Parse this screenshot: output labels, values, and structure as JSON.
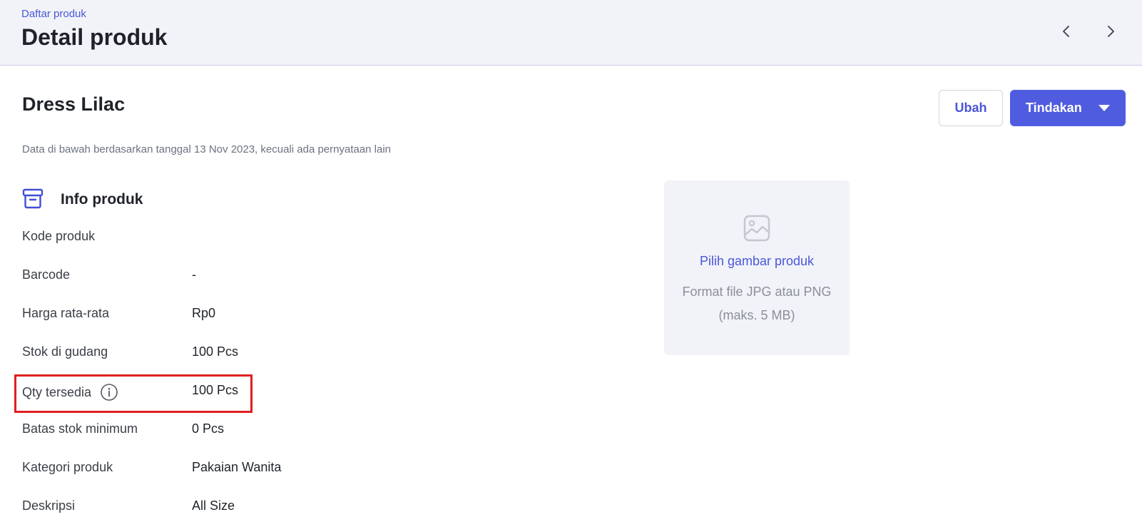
{
  "header": {
    "breadcrumb": "Daftar produk",
    "title": "Detail produk",
    "prev_icon": "chevron-left-icon",
    "next_icon": "chevron-right-icon"
  },
  "product": {
    "name": "Dress Lilac",
    "edit_label": "Ubah",
    "actions_label": "Tindakan",
    "data_note": "Data di bawah berdasarkan tanggal 13 Nov 2023, kecuali ada pernyataan lain"
  },
  "info_section": {
    "icon": "archive-box-icon",
    "title": "Info produk",
    "rows": [
      {
        "label": "Kode produk",
        "value": ""
      },
      {
        "label": "Barcode",
        "value": "-"
      },
      {
        "label": "Harga rata-rata",
        "value": "Rp0"
      },
      {
        "label": "Stok di gudang",
        "value": "100 Pcs"
      },
      {
        "label": "Qty tersedia",
        "value": "100 Pcs",
        "has_info_icon": true
      },
      {
        "label": "Batas stok minimum",
        "value": "0 Pcs"
      },
      {
        "label": "Kategori produk",
        "value": "Pakaian Wanita"
      },
      {
        "label": "Deskripsi",
        "value": "All Size"
      }
    ]
  },
  "image_upload": {
    "icon": "image-placeholder-icon",
    "link_label": "Pilih gambar produk",
    "hint": "Format file JPG atau PNG (maks. 5 MB)"
  },
  "colors": {
    "accent": "#4f5ce0",
    "link": "#4a56d9",
    "highlight": "#e02020",
    "header_bg": "#f1f3f8"
  }
}
